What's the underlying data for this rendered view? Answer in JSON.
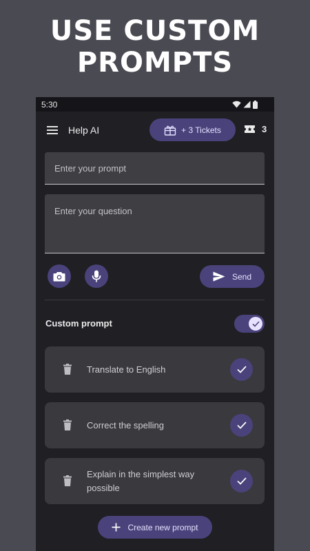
{
  "banner": {
    "line1": "USE CUSTOM",
    "line2": "PROMPTS"
  },
  "status": {
    "time": "5:30"
  },
  "appbar": {
    "title": "Help AI",
    "tickets_button": "+ 3 Tickets",
    "ticket_count": "3"
  },
  "inputs": {
    "prompt_placeholder": "Enter your prompt",
    "question_placeholder": "Enter your question"
  },
  "actions": {
    "send_label": "Send"
  },
  "custom_prompt": {
    "label": "Custom prompt",
    "enabled": true
  },
  "prompts": [
    {
      "text": "Translate to English",
      "selected": true
    },
    {
      "text": "Correct the spelling",
      "selected": true
    },
    {
      "text": "Explain in the simplest way possible",
      "selected": true
    }
  ],
  "create_button": "Create new prompt",
  "colors": {
    "accent": "#4a437b",
    "background": "#201f24",
    "card": "#3a393e",
    "banner_bg": "#4a4a52"
  },
  "icons": [
    "menu-icon",
    "gift-icon",
    "ticket-icon",
    "camera-icon",
    "mic-icon",
    "send-icon",
    "trash-icon",
    "check-icon",
    "plus-icon",
    "wifi-icon",
    "signal-icon",
    "battery-icon"
  ]
}
